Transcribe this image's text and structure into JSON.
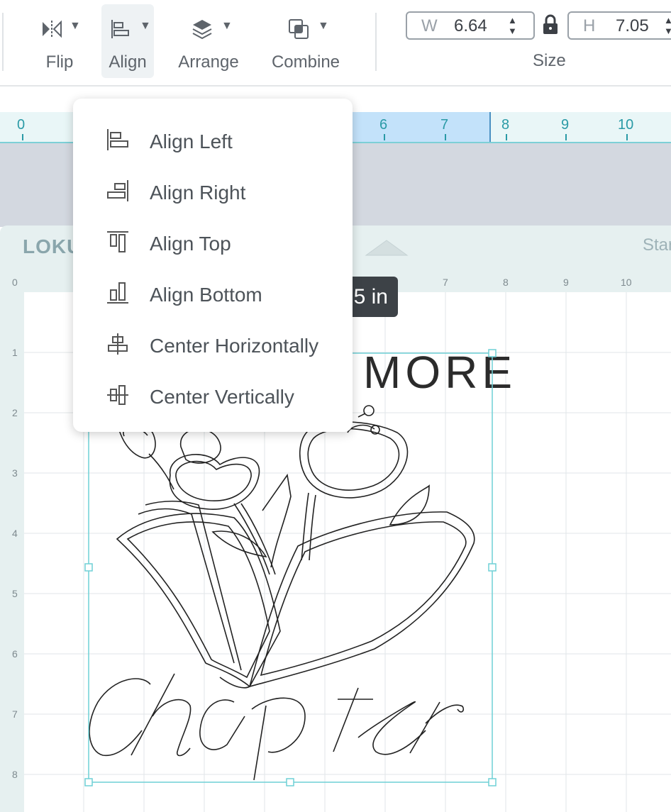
{
  "toolbar": {
    "tools": [
      {
        "label": "Flip",
        "icon": "flip-icon"
      },
      {
        "label": "Align",
        "icon": "align-icon"
      },
      {
        "label": "Arrange",
        "icon": "arrange-icon"
      },
      {
        "label": "Combine",
        "icon": "combine-icon"
      }
    ],
    "size": {
      "label": "Size",
      "width_key": "W",
      "width_value": "6.64",
      "height_key": "H",
      "height_value": "7.05"
    }
  },
  "ruler_top": [
    "0",
    "6",
    "7",
    "8",
    "9",
    "10"
  ],
  "mat": {
    "logo": "LOKU",
    "start_label": "Star",
    "ruler_x": [
      "0",
      "7",
      "8",
      "9",
      "10"
    ],
    "ruler_y": [
      "1",
      "2",
      "3",
      "4",
      "5",
      "6",
      "7",
      "8"
    ],
    "dimension_tooltip": "5 in"
  },
  "design": {
    "text_top": "MORE",
    "text_script": "Chapter"
  },
  "align_menu": {
    "items": [
      {
        "label": "Align Left",
        "icon": "align-left-icon"
      },
      {
        "label": "Align Right",
        "icon": "align-right-icon"
      },
      {
        "label": "Align Top",
        "icon": "align-top-icon"
      },
      {
        "label": "Align Bottom",
        "icon": "align-bottom-icon"
      },
      {
        "label": "Center Horizontally",
        "icon": "center-horizontally-icon"
      },
      {
        "label": "Center Vertically",
        "icon": "center-vertically-icon"
      }
    ]
  },
  "colors": {
    "accent": "#2a9aa6",
    "ruler_highlight": "#c3e2fa",
    "canvas_bg": "#d3d8e0",
    "selection": "#6fd0d6"
  }
}
